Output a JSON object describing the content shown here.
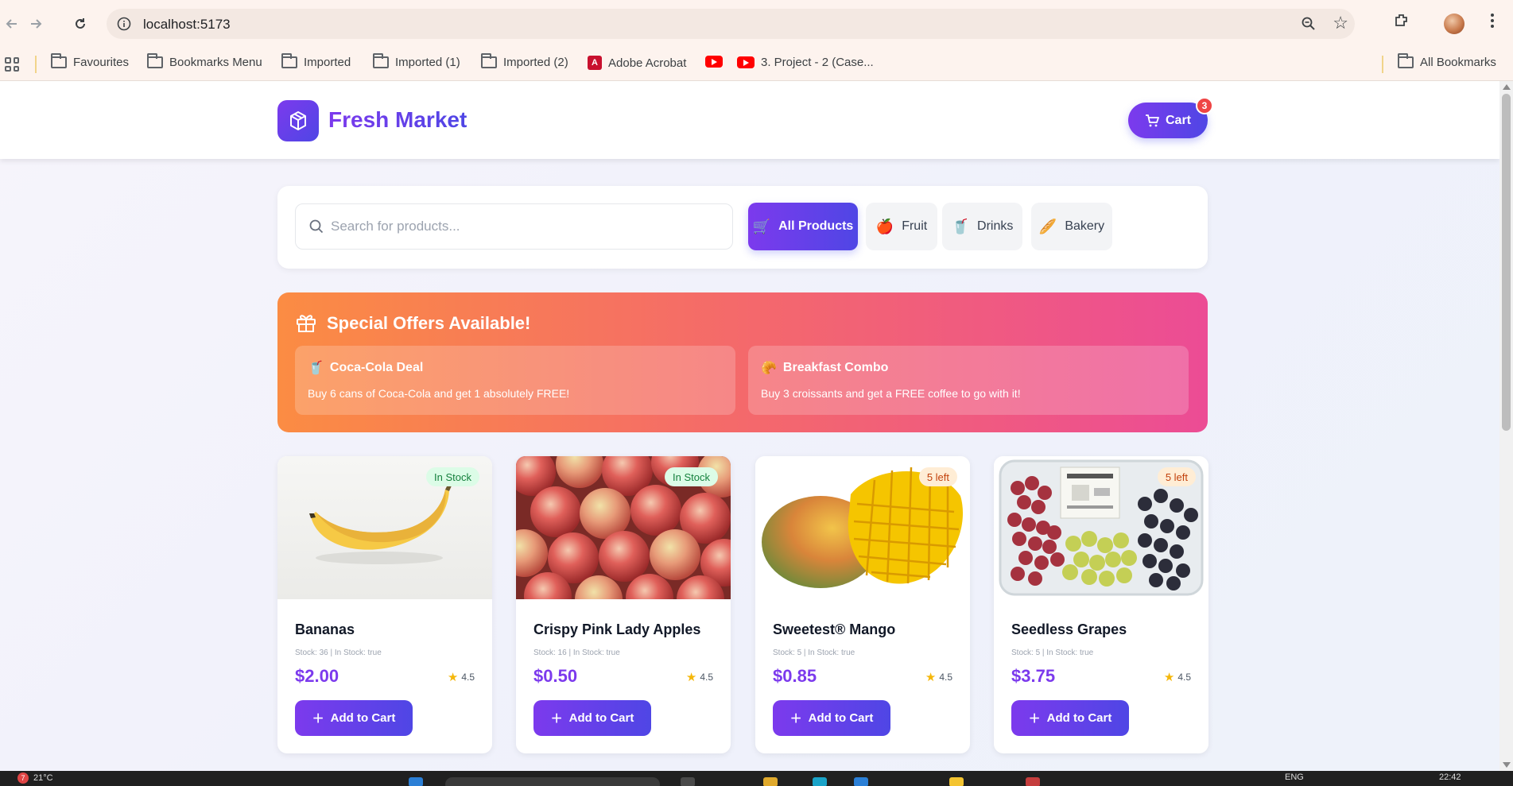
{
  "browser": {
    "url": "localhost:5173",
    "bookmarks": [
      {
        "label": "Favourites",
        "icon": "folder-icon"
      },
      {
        "label": "Bookmarks Menu",
        "icon": "folder-icon"
      },
      {
        "label": "Imported",
        "icon": "folder-icon"
      },
      {
        "label": "Imported (1)",
        "icon": "folder-icon"
      },
      {
        "label": "Imported (2)",
        "icon": "folder-icon"
      },
      {
        "label": "Adobe Acrobat",
        "icon": "acrobat-icon"
      },
      {
        "label": "",
        "icon": "youtube-icon"
      },
      {
        "label": "3. Project - 2 (Case...",
        "icon": "youtube-icon"
      }
    ],
    "all_bookmarks": "All Bookmarks"
  },
  "header": {
    "brand": "Fresh Market",
    "cart_label": "Cart",
    "cart_count": "3"
  },
  "search": {
    "placeholder": "Search for products..."
  },
  "categories": [
    {
      "label": "All Products",
      "emoji": "🛒",
      "active": true
    },
    {
      "label": "Fruit",
      "emoji": "🍎",
      "active": false
    },
    {
      "label": "Drinks",
      "emoji": "🥤",
      "active": false
    },
    {
      "label": "Bakery",
      "emoji": "🥖",
      "active": false
    }
  ],
  "offers": {
    "title": "Special Offers Available!",
    "items": [
      {
        "emoji": "🥤",
        "title": "Coca-Cola Deal",
        "desc": "Buy 6 cans of Coca-Cola and get 1 absolutely FREE!"
      },
      {
        "emoji": "🥐",
        "title": "Breakfast Combo",
        "desc": "Buy 3 croissants and get a FREE coffee to go with it!"
      }
    ]
  },
  "products": [
    {
      "name": "Bananas",
      "stock": "Stock: 36 | In Stock: true",
      "price": "$2.00",
      "rating": "4.5",
      "badge": "In Stock",
      "add_label": "Add to Cart"
    },
    {
      "name": "Crispy Pink Lady Apples",
      "stock": "Stock: 16 | In Stock: true",
      "price": "$0.50",
      "rating": "4.5",
      "badge": "In Stock",
      "add_label": "Add to Cart"
    },
    {
      "name": "Sweetest® Mango",
      "stock": "Stock: 5 | In Stock: true",
      "price": "$0.85",
      "rating": "4.5",
      "badge": "5 left",
      "add_label": "Add to Cart"
    },
    {
      "name": "Seedless Grapes",
      "stock": "Stock: 5 | In Stock: true",
      "price": "$3.75",
      "rating": "4.5",
      "badge": "5 left",
      "add_label": "Add to Cart"
    }
  ],
  "taskbar": {
    "weather_badge": "7",
    "temperature": "21°C",
    "language": "ENG",
    "time": "22:42"
  },
  "colors": {
    "accent_start": "#7c3aed",
    "accent_end": "#4f46e5",
    "offer_start": "#fb8c43",
    "offer_end": "#ec4c95",
    "in_stock": "#15803d",
    "low_stock": "#c2410c",
    "cart_badge": "#ef4444"
  }
}
